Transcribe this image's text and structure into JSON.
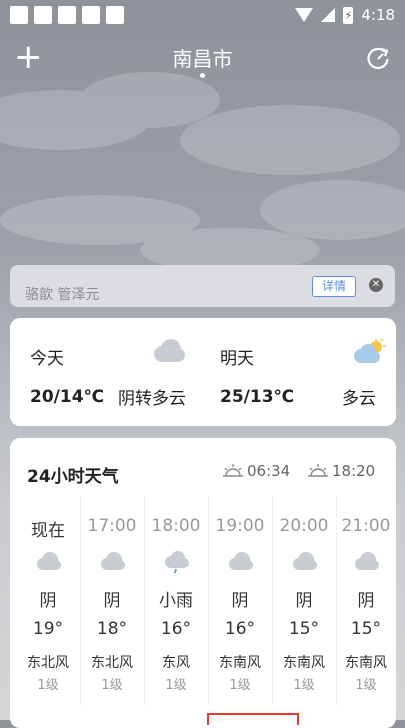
{
  "status": {
    "time": "4:18",
    "battery_glyph": "⚡"
  },
  "header": {
    "city": "南昌市"
  },
  "alert": {
    "text": "骆歆 管泽元",
    "detail_label": "详情",
    "close_glyph": "✕"
  },
  "days": [
    {
      "name": "今天",
      "temp": "20/14℃",
      "desc": "阴转多云",
      "icon": "cloud-icon"
    },
    {
      "name": "明天",
      "temp": "25/13℃",
      "desc": "多云",
      "icon": "partly-sunny-icon"
    }
  ],
  "hourly": {
    "title": "24小时天气",
    "sunrise": "06:34",
    "sunset": "18:20",
    "items": [
      {
        "time": "现在",
        "cond": "阴",
        "temp": "19°",
        "wind": "东北风",
        "level": "1级"
      },
      {
        "time": "17:00",
        "cond": "阴",
        "temp": "18°",
        "wind": "东北风",
        "level": "1级"
      },
      {
        "time": "18:00",
        "cond": "小雨",
        "temp": "16°",
        "wind": "东风",
        "level": "1级"
      },
      {
        "time": "19:00",
        "cond": "阴",
        "temp": "16°",
        "wind": "东南风",
        "level": "1级"
      },
      {
        "time": "20:00",
        "cond": "阴",
        "temp": "15°",
        "wind": "东南风",
        "level": "1级"
      },
      {
        "time": "21:00",
        "cond": "阴",
        "temp": "15°",
        "wind": "东南风",
        "level": "1级"
      }
    ]
  }
}
